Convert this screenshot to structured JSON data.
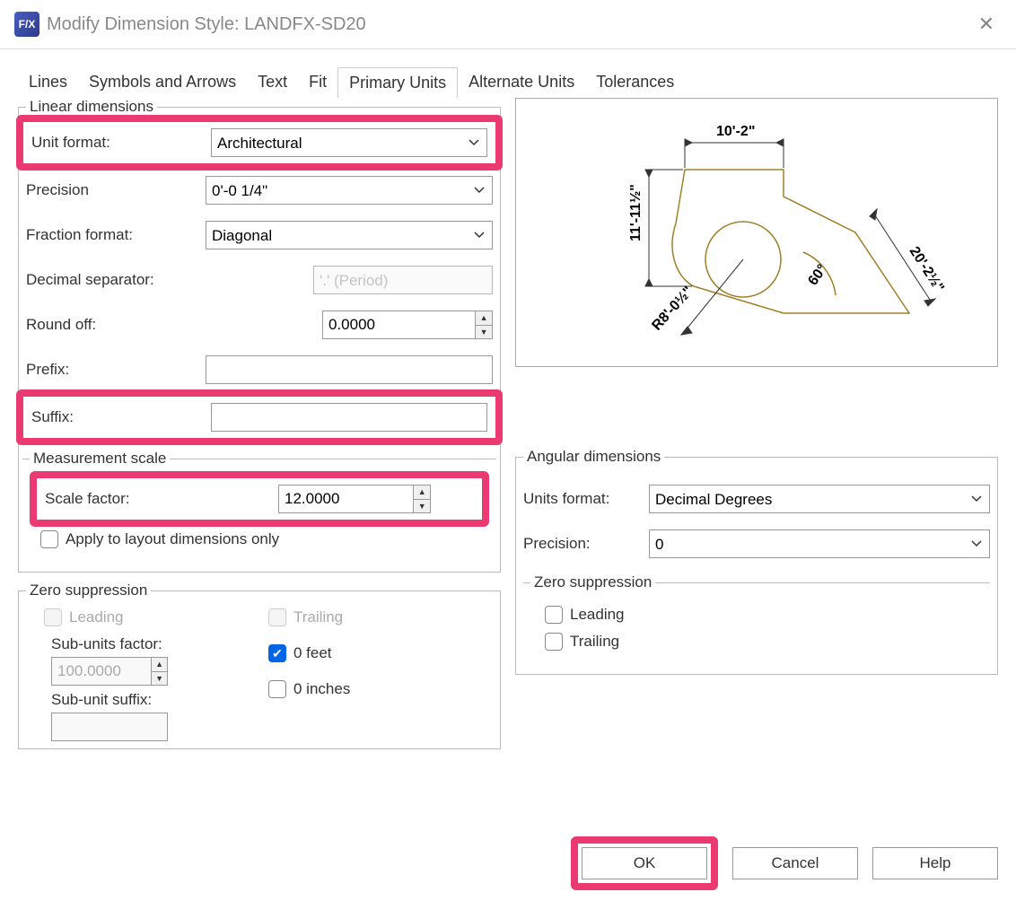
{
  "title": "Modify Dimension Style: LANDFX-SD20",
  "app_icon_text": "F/X",
  "tabs": [
    "Lines",
    "Symbols and Arrows",
    "Text",
    "Fit",
    "Primary Units",
    "Alternate Units",
    "Tolerances"
  ],
  "active_tab": "Primary Units",
  "linear": {
    "legend": "Linear dimensions",
    "unit_format_label": "Unit format:",
    "unit_format_value": "Architectural",
    "precision_label": "Precision",
    "precision_value": "0'-0 1/4\"",
    "fraction_format_label": "Fraction format:",
    "fraction_format_value": "Diagonal",
    "decimal_sep_label": "Decimal separator:",
    "decimal_sep_value": "'.' (Period)",
    "round_off_label": "Round off:",
    "round_off_value": "0.0000",
    "prefix_label": "Prefix:",
    "prefix_value": "",
    "suffix_label": "Suffix:",
    "suffix_value": ""
  },
  "measurement": {
    "legend": "Measurement scale",
    "scale_factor_label": "Scale factor:",
    "scale_factor_value": "12.0000",
    "apply_layout_label": "Apply to layout dimensions only"
  },
  "zero_supp": {
    "legend": "Zero suppression",
    "leading_label": "Leading",
    "trailing_label": "Trailing",
    "subunits_factor_label": "Sub-units factor:",
    "subunits_factor_value": "100.0000",
    "subunit_suffix_label": "Sub-unit suffix:",
    "subunit_suffix_value": "",
    "zero_feet_label": "0 feet",
    "zero_inches_label": "0 inches"
  },
  "angular": {
    "legend": "Angular dimensions",
    "units_format_label": "Units format:",
    "units_format_value": "Decimal Degrees",
    "precision_label": "Precision:",
    "precision_value": "0",
    "zs_legend": "Zero suppression",
    "leading_label": "Leading",
    "trailing_label": "Trailing"
  },
  "preview": {
    "dim_top": "10'-2\"",
    "dim_left": "11'-11½\"",
    "dim_diag": "20'-2½\"",
    "dim_angle": "60°",
    "dim_radius": "R8'-0½\""
  },
  "buttons": {
    "ok": "OK",
    "cancel": "Cancel",
    "help": "Help"
  }
}
